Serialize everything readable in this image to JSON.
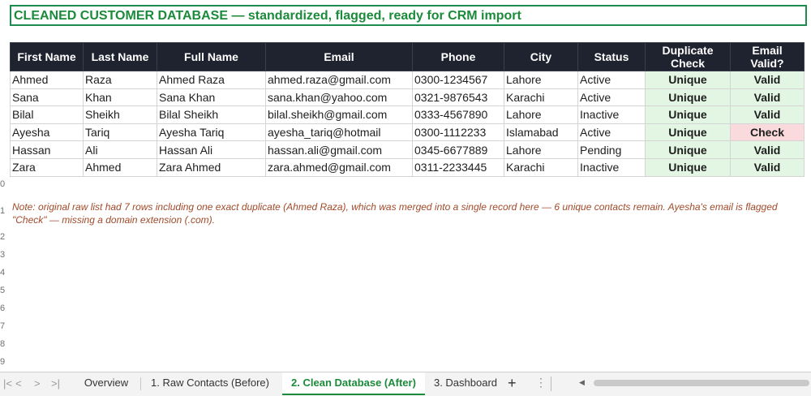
{
  "title": "CLEANED CUSTOMER DATABASE — standardized, flagged, ready for CRM import",
  "table": {
    "headers": [
      {
        "line1": "First Name",
        "line2": ""
      },
      {
        "line1": "Last Name",
        "line2": ""
      },
      {
        "line1": "Full Name",
        "line2": ""
      },
      {
        "line1": "Email",
        "line2": ""
      },
      {
        "line1": "Phone",
        "line2": ""
      },
      {
        "line1": "City",
        "line2": ""
      },
      {
        "line1": "Status",
        "line2": ""
      },
      {
        "line1": "Duplicate",
        "line2": "Check"
      },
      {
        "line1": "Email",
        "line2": "Valid?"
      }
    ],
    "rows": [
      [
        "Ahmed",
        "Raza",
        "Ahmed Raza",
        "ahmed.raza@gmail.com",
        "0300-1234567",
        "Lahore",
        "Active",
        "Unique",
        "Valid"
      ],
      [
        "Sana",
        "Khan",
        "Sana Khan",
        "sana.khan@yahoo.com",
        "0321-9876543",
        "Karachi",
        "Active",
        "Unique",
        "Valid"
      ],
      [
        "Bilal",
        "Sheikh",
        "Bilal Sheikh",
        "bilal.sheikh@gmail.com",
        "0333-4567890",
        "Lahore",
        "Inactive",
        "Unique",
        "Valid"
      ],
      [
        "Ayesha",
        "Tariq",
        "Ayesha Tariq",
        "ayesha_tariq@hotmail",
        "0300-1112233",
        "Islamabad",
        "Active",
        "Unique",
        "Check"
      ],
      [
        "Hassan",
        "Ali",
        "Hassan Ali",
        "hassan.ali@gmail.com",
        "0345-6677889",
        "Lahore",
        "Pending",
        "Unique",
        "Valid"
      ],
      [
        "Zara",
        "Ahmed",
        "Zara Ahmed",
        "zara.ahmed@gmail.com",
        "0311-2233445",
        "Karachi",
        "Inactive",
        "Unique",
        "Valid"
      ]
    ]
  },
  "note": "Note: original raw list had 7 rows including one exact duplicate (Ahmed Raza), which was merged into a single record here — 6 unique contacts remain. Ayesha's email is flagged \"Check\" — missing a domain extension (.com).",
  "row_numbers": [
    "0",
    "1",
    "2",
    "3",
    "4",
    "5",
    "6",
    "7",
    "8",
    "9"
  ],
  "tabs": [
    {
      "label": "Overview",
      "active": false
    },
    {
      "label": "1. Raw Contacts (Before)",
      "active": false
    },
    {
      "label": "2. Clean Database (After)",
      "active": true
    },
    {
      "label": "3. Dashboard",
      "active": false
    }
  ],
  "nav": {
    "first": "|<",
    "prev": "<",
    "next": ">",
    "last": ">|",
    "add": "+"
  },
  "colors": {
    "accent": "#1b8a3a",
    "header_bg": "#1f2330",
    "valid_bg": "#e3f5e3",
    "warn_bg": "#fadadd",
    "note": "#a24a2a"
  }
}
